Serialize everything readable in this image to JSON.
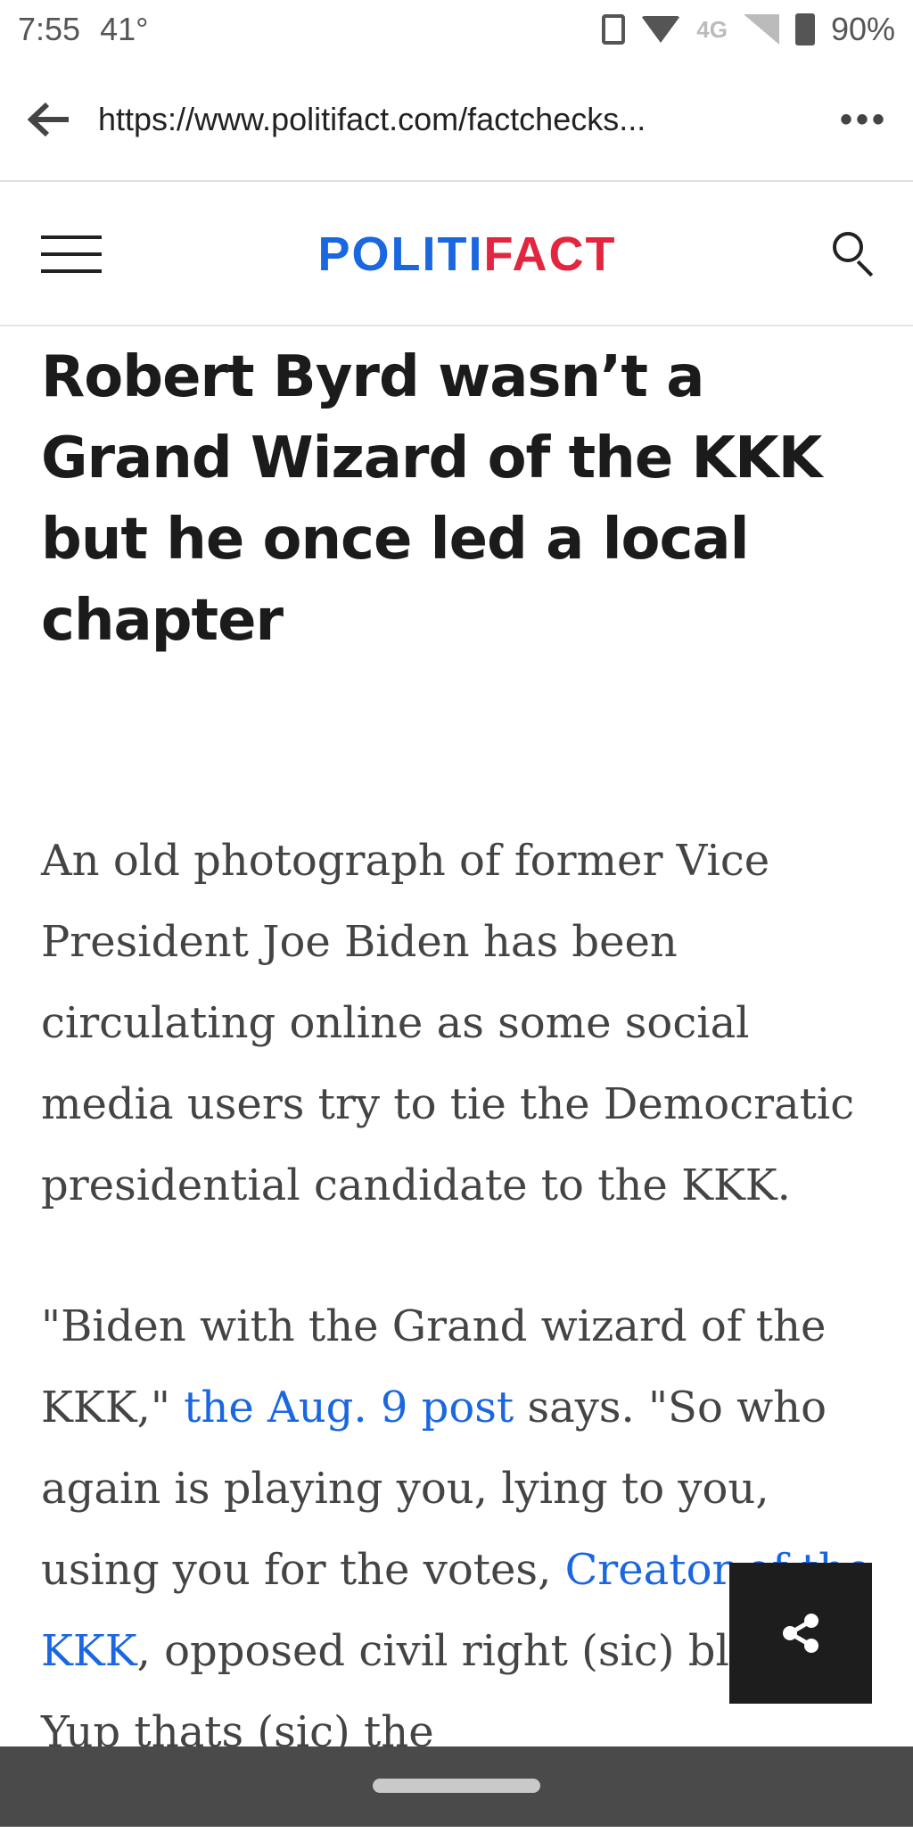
{
  "status_bar": {
    "time": "7:55",
    "temperature": "41°",
    "network": "4G",
    "battery": "90%"
  },
  "browser": {
    "url": "https://www.politifact.com/factchecks...",
    "more_label": "•••"
  },
  "site": {
    "logo_blue": "POLITI",
    "logo_red": "FACT",
    "brand_blue": "#1a67e0",
    "brand_red": "#e2263f"
  },
  "article": {
    "headline": "Robert Byrd wasn’t a Grand Wizard of the KKK but he once led a local chapter",
    "para1": "An old photograph of former Vice President Joe Biden has been circulating online as some social media users try to tie the Democratic presidential candidate to the KKK.",
    "para2_part1": "\"Biden with the Grand wizard of the KKK,\" ",
    "para2_link1": "the Aug. 9 post",
    "para2_part2": " says. \"So who again is playing you, lying to you, using you for the votes, ",
    "para2_link2": "Creator of the KKK",
    "para2_part3": ", opposed civil right (sic) blacks. Yup thats (sic) the"
  },
  "icons": {
    "back": "arrow-left-icon",
    "menu": "hamburger-icon",
    "search": "search-icon",
    "share": "share-icon"
  }
}
